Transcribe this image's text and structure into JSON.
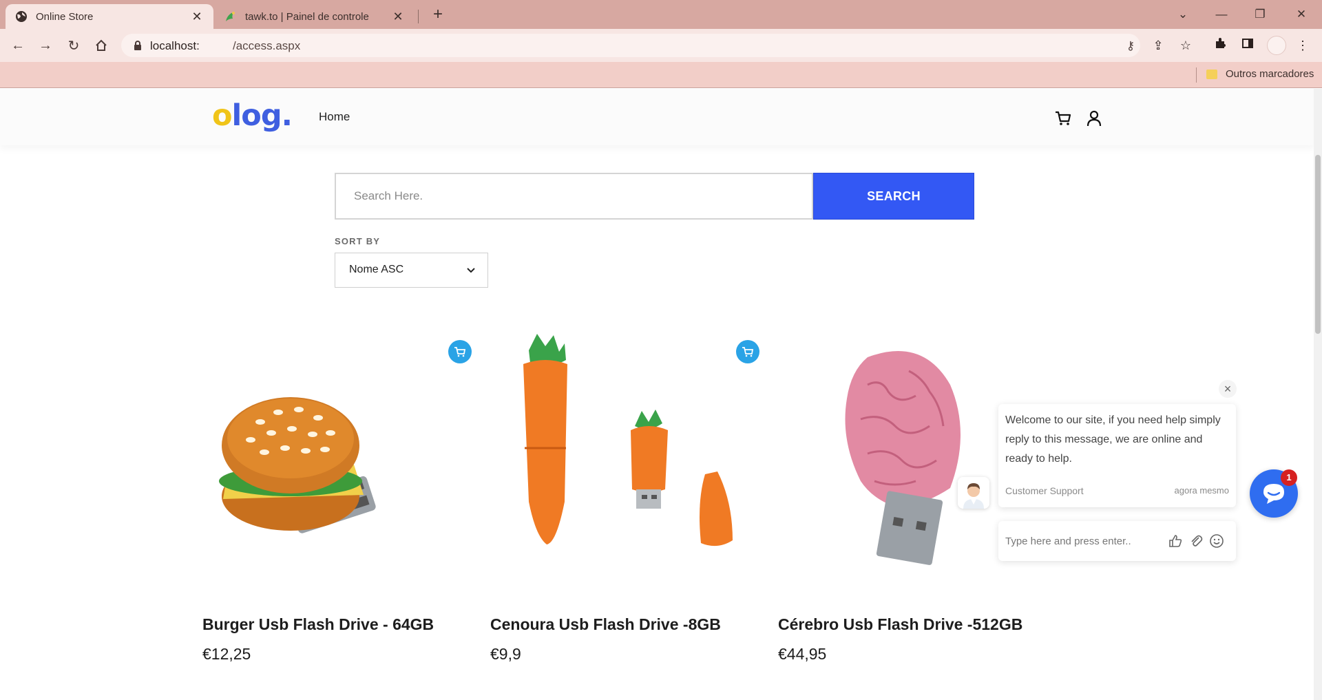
{
  "browser": {
    "tabs": [
      {
        "title": "Online Store",
        "active": true,
        "favicon": "globe-icon"
      },
      {
        "title": "tawk.to | Painel de controle",
        "active": false,
        "favicon": "tawk-icon"
      }
    ],
    "url_host": "localhost:",
    "url_path": "/access.aspx",
    "bookmarks_folder": "Outros marcadores"
  },
  "site": {
    "logo": {
      "first": "o",
      "rest": "log."
    },
    "nav_home": "Home"
  },
  "search": {
    "placeholder": "Search Here.",
    "button": "SEARCH"
  },
  "sort": {
    "label": "SORT BY",
    "selected": "Nome ASC"
  },
  "products": [
    {
      "name": "Burger Usb Flash Drive - 64GB",
      "price": "€12,25"
    },
    {
      "name": "Cenoura Usb Flash Drive -8GB",
      "price": "€9,9"
    },
    {
      "name": "Cérebro Usb Flash Drive -512GB",
      "price": "€44,95"
    }
  ],
  "chat": {
    "message": "Welcome to our site, if you need help simply reply to this message, we are online and ready to help.",
    "sender": "Customer Support",
    "time": "agora mesmo",
    "input_placeholder": "Type here and press enter..",
    "unread": "1"
  },
  "colors": {
    "accent": "#3358f4",
    "logo_yellow": "#f0c419",
    "cart_badge": "#2aa3e6",
    "chat_launcher": "#2f6df0"
  }
}
